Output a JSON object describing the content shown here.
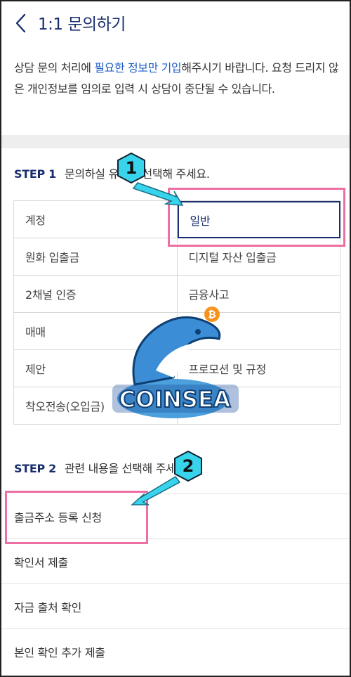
{
  "header": {
    "title": "1:1 문의하기",
    "back_icon": "chevron-left-icon"
  },
  "notice": {
    "part1": "상담 문의 처리에 ",
    "highlight": "필요한 정보만 기입",
    "part2": "해주시기 바랍니다. 요청 드리지 않은 개인정보를 임의로 입력 시 상담이 중단될 수 있습니다."
  },
  "step1": {
    "label": "STEP 1",
    "text": "문의하실 유형을 선택해 주세요.",
    "categories": [
      [
        "계정",
        "일반"
      ],
      [
        "원화 입출금",
        "디지털 자산 입출금"
      ],
      [
        "2채널 인증",
        "금융사고"
      ],
      [
        "매매",
        ""
      ],
      [
        "제안",
        "프로모션 및 규정"
      ],
      [
        "착오전송(오입금)",
        ""
      ]
    ],
    "selected": "일반"
  },
  "step2": {
    "label": "STEP 2",
    "text": "관련 내용을 선택해 주세요.",
    "items": [
      "출금주소 등록 신청",
      "확인서 제출",
      "자금 출처 확인",
      "본인 확인 추가 제출"
    ]
  },
  "callouts": {
    "one": "1",
    "two": "2"
  },
  "watermark": {
    "text": "COINSEA"
  },
  "colors": {
    "navy": "#1a2e6e",
    "link_blue": "#1f5fc9",
    "highlight_pink": "#ee6fa4",
    "callout_cyan": "#37d4ec"
  }
}
